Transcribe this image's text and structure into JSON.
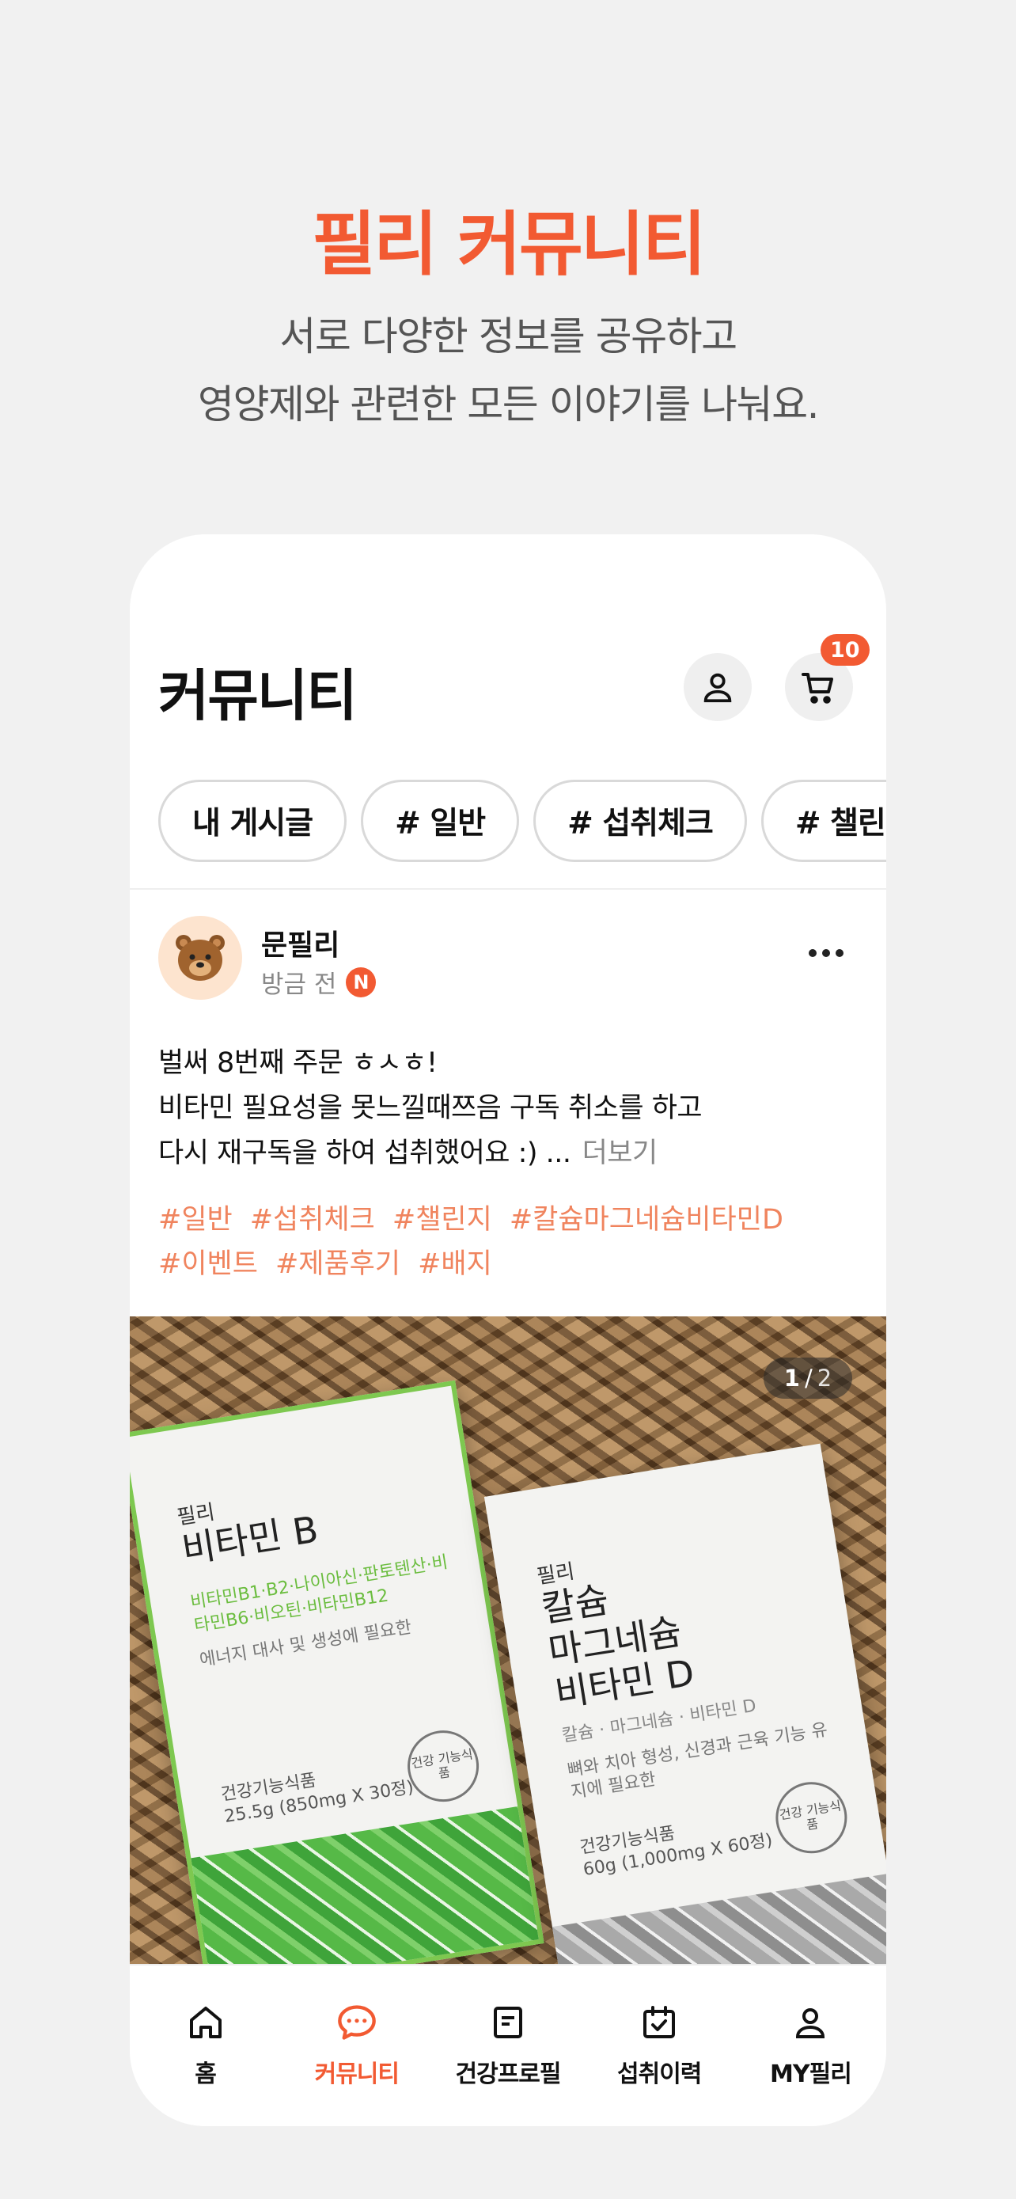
{
  "promo": {
    "title": "필리 커뮤니티",
    "subtitle_line1": "서로 다양한 정보를 공유하고",
    "subtitle_line2": "영양제와 관련한 모든 이야기를 나눠요."
  },
  "header": {
    "title": "커뮤니티",
    "cart_badge": "10",
    "profile_icon": "person-icon",
    "cart_icon": "cart-icon"
  },
  "chips": [
    {
      "label": "내 게시글"
    },
    {
      "label": "# 일반"
    },
    {
      "label": "# 섭취체크"
    },
    {
      "label": "# 챌린지"
    }
  ],
  "post": {
    "author": "문필리",
    "time": "방금 전",
    "new_badge": "N",
    "body_line1": "벌써 8번째 주문 ㅎㅅㅎ!",
    "body_line2": "비타민 필요성을 못느낄때쯔음 구독 취소를 하고",
    "body_line3": "다시 재구독을 하여 섭취했어요 :) ...",
    "see_more": "더보기",
    "tags": [
      "#일반",
      "#섭취체크",
      "#챌린지",
      "#칼슘마그네슘비타민D",
      "#이벤트",
      "#제품후기",
      "#배지"
    ],
    "image_counter_current": "1",
    "image_counter_sep": "/",
    "image_counter_total": "2",
    "photo": {
      "box_a": {
        "brand": "필리",
        "name": "비타민 B",
        "ingredients": "비타민B1·B2·나이아신·판토텐산·비타민B6·비오틴·비타민B12",
        "desc": "에너지 대사 및 생성에 필요한",
        "food_type": "건강기능식품",
        "amount": "25.5g (850mg X 30정)",
        "seal": "건강 기능식품"
      },
      "box_b": {
        "brand": "필리",
        "name_line1": "칼슘",
        "name_line2": "마그네슘",
        "name_line3": "비타민 D",
        "ingredients": "칼슘 · 마그네슘 · 비타민 D",
        "desc": "뼈와 치아 형성, 신경과 근육 기능 유지에 필요한",
        "food_type": "건강기능식품",
        "amount": "60g (1,000mg X 60정)",
        "seal": "건강 기능식품"
      }
    }
  },
  "tabbar": [
    {
      "label": "홈",
      "icon": "home-icon"
    },
    {
      "label": "커뮤니티",
      "icon": "chat-bubble-icon",
      "active": true
    },
    {
      "label": "건강프로필",
      "icon": "document-icon"
    },
    {
      "label": "섭취이력",
      "icon": "calendar-check-icon"
    },
    {
      "label": "MY필리",
      "icon": "person-icon"
    }
  ],
  "colors": {
    "accent": "#f25a32",
    "tag": "#f0845e",
    "background": "#f1f1f1"
  }
}
